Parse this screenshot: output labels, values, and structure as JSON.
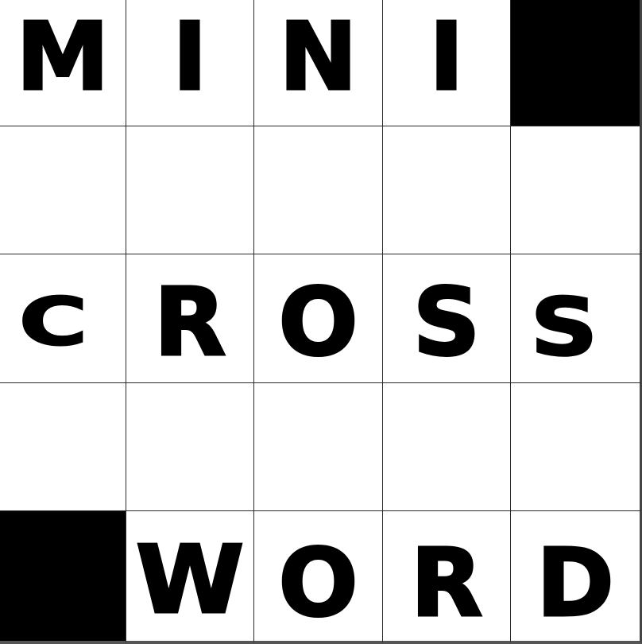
{
  "puzzle": {
    "rows": 5,
    "cols": 5,
    "grid": [
      [
        "M",
        "I",
        "N",
        "I",
        "#"
      ],
      [
        "",
        "",
        "",
        "",
        ""
      ],
      [
        "C",
        "R",
        "O",
        "S",
        "S"
      ],
      [
        "",
        "",
        "",
        "",
        ""
      ],
      [
        "#",
        "W",
        "O",
        "R",
        "D"
      ]
    ]
  },
  "colors": {
    "block": "#000000",
    "cell": "#ffffff",
    "grid_line": "#2a2a2a",
    "letter": "#000000"
  }
}
